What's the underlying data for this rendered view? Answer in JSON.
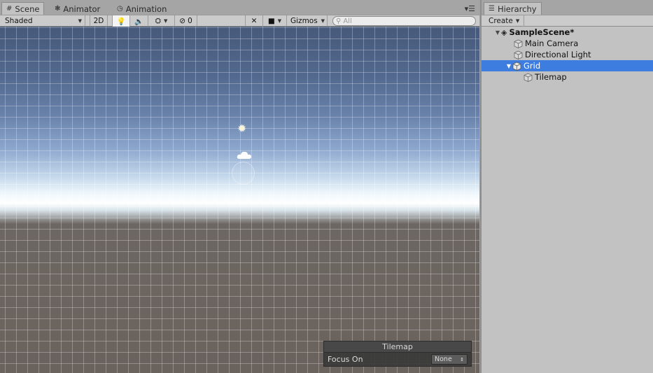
{
  "scene_panel": {
    "tabs": [
      {
        "label": "Scene",
        "icon": "grid-icon"
      },
      {
        "label": "Animator",
        "icon": "animator-icon"
      },
      {
        "label": "Animation",
        "icon": "clock-icon"
      }
    ],
    "toolbar": {
      "draw_mode": "Shaded",
      "mode_2d": "2D",
      "hidden_count": "0",
      "gizmos": "Gizmos",
      "search_placeholder": "All"
    },
    "overlay": {
      "title": "Tilemap",
      "focus_label": "Focus On",
      "focus_value": "None"
    }
  },
  "hierarchy_panel": {
    "tab_label": "Hierarchy",
    "create_label": "Create",
    "scene_name": "SampleScene*",
    "items": [
      {
        "label": "Main Camera"
      },
      {
        "label": "Directional Light"
      },
      {
        "label": "Grid"
      },
      {
        "label": "Tilemap"
      }
    ]
  },
  "colors": {
    "selection": "#3e7de0",
    "panel_bg": "#c2c2c2"
  }
}
